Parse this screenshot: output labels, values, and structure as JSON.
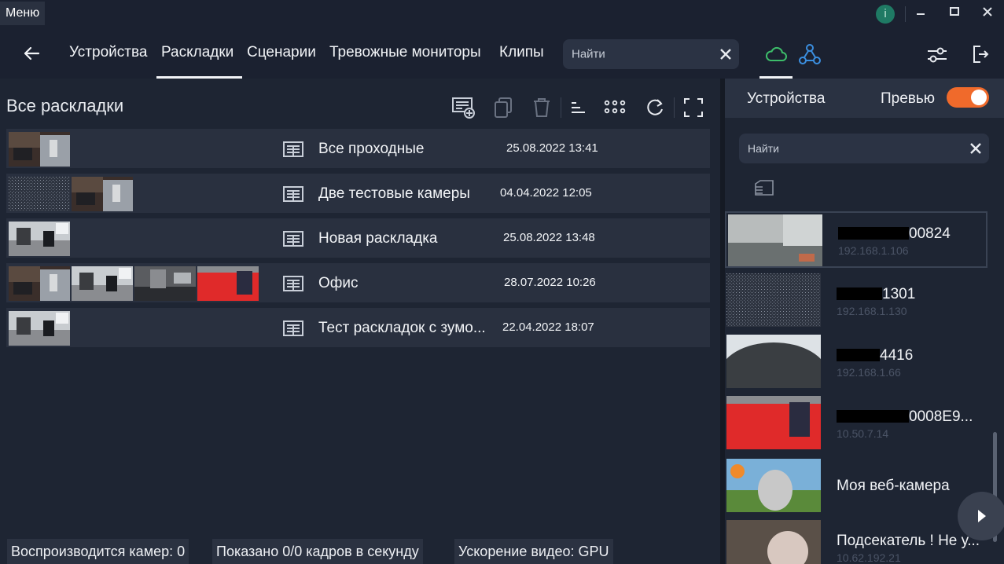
{
  "titlebar": {
    "menu_label": "Меню",
    "info_label": "i"
  },
  "nav": {
    "tabs": [
      {
        "label": "Устройства"
      },
      {
        "label": "Раскладки"
      },
      {
        "label": "Сценарии"
      },
      {
        "label": "Тревожные мониторы"
      },
      {
        "label": "Клипы"
      }
    ],
    "active_tab": "Раскладки",
    "search_placeholder": "Найти"
  },
  "layouts": {
    "title": "Все раскладки",
    "rows": [
      {
        "name": "Все проходные",
        "date": "25.08.2022 13:41",
        "thumbs": [
          "office"
        ]
      },
      {
        "name": "Две тестовые камеры",
        "date": "04.04.2022 12:05",
        "thumbs": [
          "noise",
          "office"
        ]
      },
      {
        "name": "Новая раскладка",
        "date": "25.08.2022 13:48",
        "thumbs": [
          "lab"
        ]
      },
      {
        "name": "Офис",
        "date": "28.07.2022 10:26",
        "thumbs": [
          "office",
          "lab",
          "grey",
          "red"
        ]
      },
      {
        "name": "Тест раскладок с зумо...",
        "date": "22.04.2022 18:07",
        "thumbs": [
          "lab"
        ]
      }
    ]
  },
  "status": {
    "cameras": "Воспроизводится камер: 0",
    "fps": "Показано 0/0 кадров в секунду",
    "accel": "Ускорение видео: GPU"
  },
  "devices_panel": {
    "title": "Устройства",
    "preview_label": "Превью",
    "preview_on": true,
    "search_placeholder": "Найти",
    "items": [
      {
        "name_suffix": "00824",
        "ip": "192.168.1.106",
        "thumb": "room"
      },
      {
        "name_suffix": "1301",
        "ip": "192.168.1.130",
        "thumb": "noise"
      },
      {
        "name_suffix": "4416",
        "ip": "192.168.1.66",
        "thumb": "fisheye"
      },
      {
        "name_suffix": "0008E9...",
        "ip": "10.50.7.14",
        "thumb": "red"
      },
      {
        "name": "Моя веб-камера",
        "ip": "",
        "thumb": "bunny"
      },
      {
        "name": "Подсекатель ! Не у...",
        "ip": "10.62.192.21",
        "thumb": "closeup"
      }
    ]
  },
  "colors": {
    "accent_orange": "#f06a2b",
    "cloud_green": "#3dbd6a",
    "network_blue": "#3b8fe0"
  }
}
